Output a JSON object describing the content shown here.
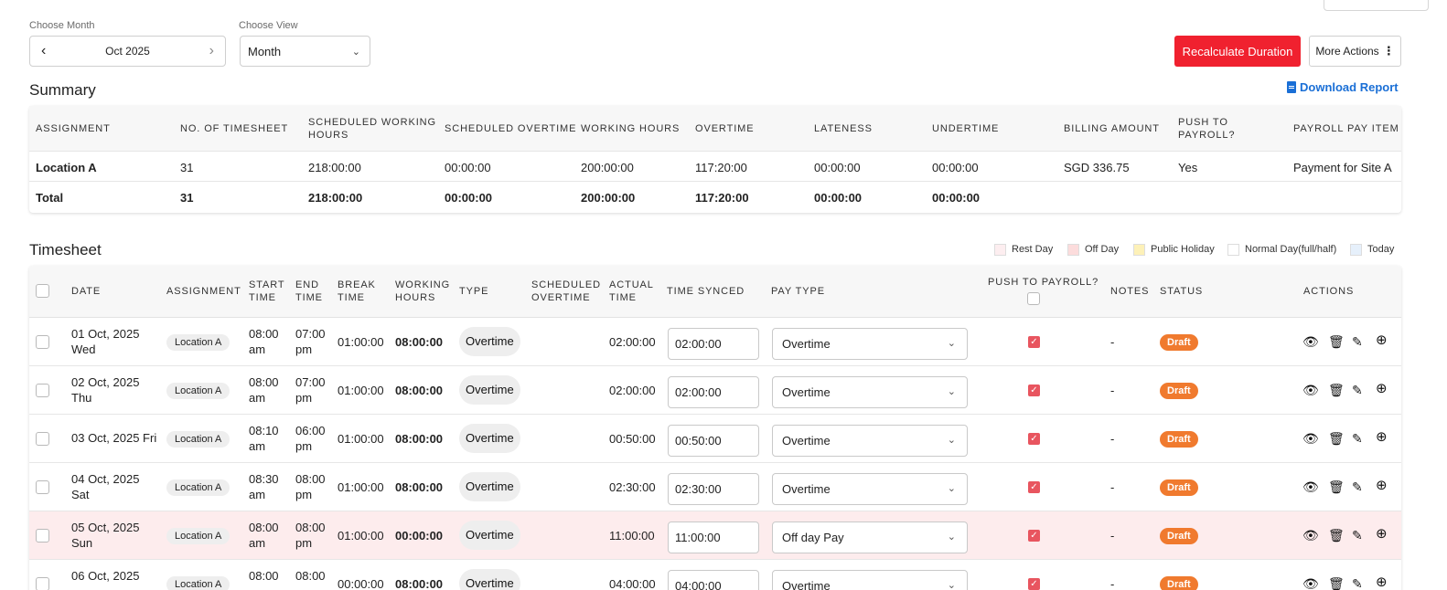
{
  "filters": {
    "month_label": "Choose Month",
    "month_value": "Oct 2025",
    "view_label": "Choose View",
    "view_value": "Month"
  },
  "actions": {
    "recalculate": "Recalculate Duration",
    "more": "More Actions"
  },
  "summary": {
    "title": "Summary",
    "download": "Download Report",
    "headers": [
      "Assignment",
      "No. of Timesheet",
      "Scheduled Working Hours",
      "Scheduled Overtime",
      "Working Hours",
      "Overtime",
      "Lateness",
      "Undertime",
      "Billing Amount",
      "Push to Payroll?",
      "Payroll Pay Item"
    ],
    "rows": [
      [
        "Location A",
        "31",
        "218:00:00",
        "00:00:00",
        "200:00:00",
        "117:20:00",
        "00:00:00",
        "00:00:00",
        "SGD 336.75",
        "Yes",
        "Payment for Site A"
      ],
      [
        "Total",
        "31",
        "218:00:00",
        "00:00:00",
        "200:00:00",
        "117:20:00",
        "00:00:00",
        "00:00:00",
        "",
        "",
        ""
      ]
    ]
  },
  "timesheet": {
    "title": "Timesheet",
    "legend": [
      {
        "label": "Rest Day",
        "color": "#fdeef0"
      },
      {
        "label": "Off Day",
        "color": "#fcdcdc"
      },
      {
        "label": "Public Holiday",
        "color": "#fdf1b8"
      },
      {
        "label": "Normal Day(full/half)",
        "color": "#ffffff"
      },
      {
        "label": "Today",
        "color": "#e6f0fb"
      }
    ],
    "headers": [
      "Date",
      "Assignment",
      "Start Time",
      "End Time",
      "Break Time",
      "Working Hours",
      "Type",
      "Scheduled Overtime",
      "Actual Time",
      "Time Synced",
      "Pay Type",
      "Push to Payroll?",
      "Notes",
      "Status",
      "Actions"
    ],
    "rows": [
      {
        "date": "01 Oct, 2025 Wed",
        "assignment": "Location A",
        "start": "08:00 am",
        "end": "07:00 pm",
        "break": "01:00:00",
        "working": "08:00:00",
        "type": "Overtime",
        "actual": "02:00:00",
        "synced": "02:00:00",
        "pay_type": "Overtime",
        "notes": "-",
        "status": "Draft"
      },
      {
        "date": "02 Oct, 2025 Thu",
        "assignment": "Location A",
        "start": "08:00 am",
        "end": "07:00 pm",
        "break": "01:00:00",
        "working": "08:00:00",
        "type": "Overtime",
        "actual": "02:00:00",
        "synced": "02:00:00",
        "pay_type": "Overtime",
        "notes": "-",
        "status": "Draft"
      },
      {
        "date": "03 Oct, 2025 Fri",
        "assignment": "Location A",
        "start": "08:10 am",
        "end": "06:00 pm",
        "break": "01:00:00",
        "working": "08:00:00",
        "type": "Overtime",
        "actual": "00:50:00",
        "synced": "00:50:00",
        "pay_type": "Overtime",
        "notes": "-",
        "status": "Draft"
      },
      {
        "date": "04 Oct, 2025 Sat",
        "assignment": "Location A",
        "start": "08:30 am",
        "end": "08:00 pm",
        "break": "01:00:00",
        "working": "08:00:00",
        "type": "Overtime",
        "actual": "02:30:00",
        "synced": "02:30:00",
        "pay_type": "Overtime",
        "notes": "-",
        "status": "Draft"
      },
      {
        "date": "05 Oct, 2025 Sun",
        "assignment": "Location A",
        "start": "08:00 am",
        "end": "08:00 pm",
        "break": "01:00:00",
        "working": "00:00:00",
        "type": "Overtime",
        "actual": "11:00:00",
        "synced": "11:00:00",
        "pay_type": "Off day Pay",
        "notes": "-",
        "status": "Draft"
      },
      {
        "date": "06 Oct, 2025",
        "assignment": "Location A",
        "start": "08:00",
        "end": "08:00",
        "break": "00:00:00",
        "working": "08:00:00",
        "type": "Overtime",
        "actual": "04:00:00",
        "synced": "04:00:00",
        "pay_type": "Overtime",
        "notes": "-",
        "status": "Draft"
      }
    ]
  },
  "icons": [
    "chevron-left-icon",
    "chevron-right-icon",
    "chevron-down-icon",
    "kebab-icon",
    "document-icon",
    "eye-icon",
    "trash-icon",
    "pencil-icon",
    "plus-circle-icon",
    "checkbox-icon"
  ]
}
